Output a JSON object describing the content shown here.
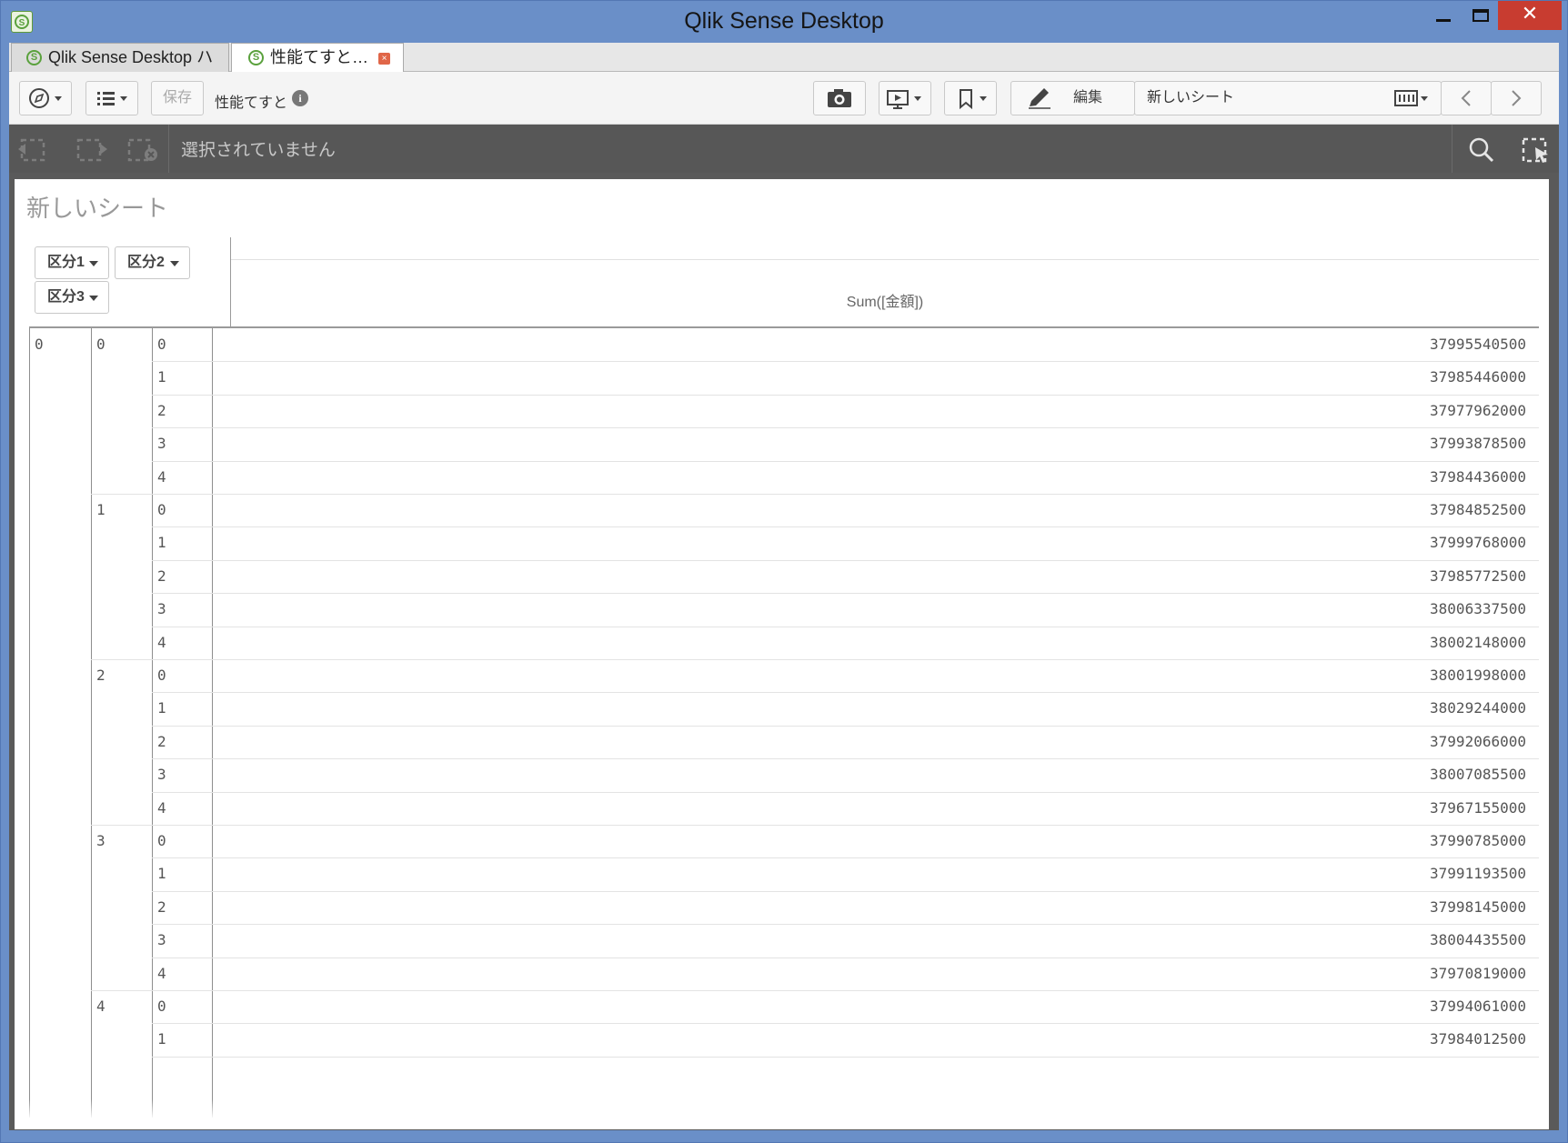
{
  "window": {
    "title": "Qlik Sense Desktop",
    "close_glyph": "✕"
  },
  "tabs": [
    {
      "label": "Qlik Sense Desktop ハブ",
      "icon": "qlik-sense-icon"
    },
    {
      "label": "性能てすと…",
      "icon": "qlik-sense-icon",
      "close_glyph": "×"
    }
  ],
  "toolbar": {
    "save_label": "保存",
    "app_title": "性能てすと",
    "info_glyph": "i",
    "edit_label": "編集",
    "sheet_name": "新しいシート"
  },
  "selections": {
    "status": "選択されていません"
  },
  "sheet": {
    "title": "新しいシート"
  },
  "pivot": {
    "dimensions": [
      "区分1",
      "区分2",
      "区分3"
    ],
    "measure": "Sum([金額])",
    "rows": [
      {
        "d1": "0",
        "d2": "0",
        "d3": "0",
        "value": "37995540500"
      },
      {
        "d1": "",
        "d2": "",
        "d3": "1",
        "value": "37985446000"
      },
      {
        "d1": "",
        "d2": "",
        "d3": "2",
        "value": "37977962000"
      },
      {
        "d1": "",
        "d2": "",
        "d3": "3",
        "value": "37993878500"
      },
      {
        "d1": "",
        "d2": "",
        "d3": "4",
        "value": "37984436000"
      },
      {
        "d1": "",
        "d2": "1",
        "d3": "0",
        "value": "37984852500"
      },
      {
        "d1": "",
        "d2": "",
        "d3": "1",
        "value": "37999768000"
      },
      {
        "d1": "",
        "d2": "",
        "d3": "2",
        "value": "37985772500"
      },
      {
        "d1": "",
        "d2": "",
        "d3": "3",
        "value": "38006337500"
      },
      {
        "d1": "",
        "d2": "",
        "d3": "4",
        "value": "38002148000"
      },
      {
        "d1": "",
        "d2": "2",
        "d3": "0",
        "value": "38001998000"
      },
      {
        "d1": "",
        "d2": "",
        "d3": "1",
        "value": "38029244000"
      },
      {
        "d1": "",
        "d2": "",
        "d3": "2",
        "value": "37992066000"
      },
      {
        "d1": "",
        "d2": "",
        "d3": "3",
        "value": "38007085500"
      },
      {
        "d1": "",
        "d2": "",
        "d3": "4",
        "value": "37967155000"
      },
      {
        "d1": "",
        "d2": "3",
        "d3": "0",
        "value": "37990785000"
      },
      {
        "d1": "",
        "d2": "",
        "d3": "1",
        "value": "37991193500"
      },
      {
        "d1": "",
        "d2": "",
        "d3": "2",
        "value": "37998145000"
      },
      {
        "d1": "",
        "d2": "",
        "d3": "3",
        "value": "38004435500"
      },
      {
        "d1": "",
        "d2": "",
        "d3": "4",
        "value": "37970819000"
      },
      {
        "d1": "",
        "d2": "4",
        "d3": "0",
        "value": "37994061000"
      },
      {
        "d1": "",
        "d2": "",
        "d3": "1",
        "value": "37984012500"
      }
    ]
  }
}
